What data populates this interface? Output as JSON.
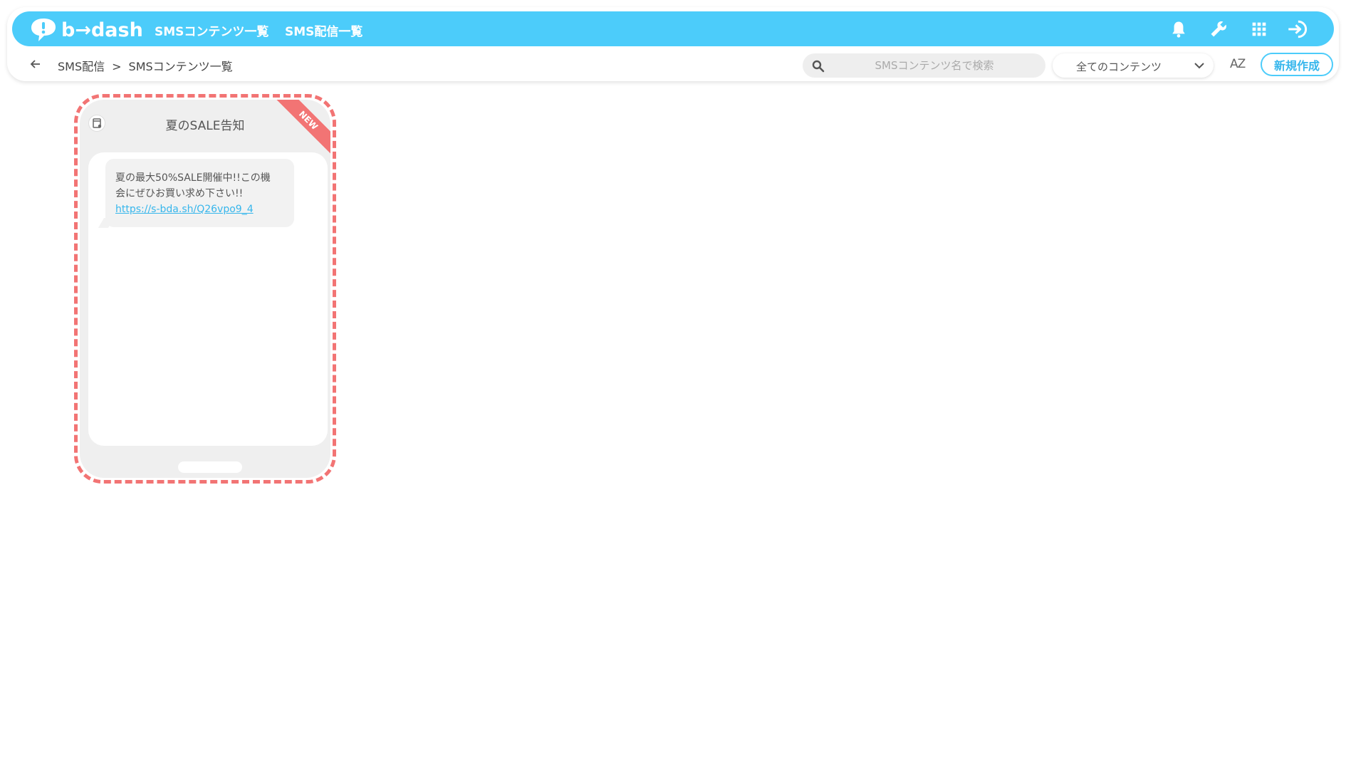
{
  "app": {
    "logo_text": "b→dash",
    "brand_color": "#4cccfa",
    "accent_color": "#f27474"
  },
  "nav": {
    "items": [
      {
        "label": "SMSコンテンツ一覧"
      },
      {
        "label": "SMS配信一覧"
      }
    ],
    "icons": [
      "bell-icon",
      "wrench-icon",
      "apps-grid-icon",
      "logout-icon"
    ]
  },
  "breadcrumb": {
    "parent": "SMS配信",
    "separator": ">",
    "current": "SMSコンテンツ一覧"
  },
  "search": {
    "placeholder": "SMSコンテンツ名で検索",
    "value": ""
  },
  "filter": {
    "selected": "全てのコンテンツ"
  },
  "sort": {
    "label": "AZ"
  },
  "toolbar": {
    "new_label": "新規作成"
  },
  "cards": [
    {
      "badge": "NEW",
      "title": "夏のSALE告知",
      "message_line1": "夏の最大50%SALE開催中!!この機",
      "message_line2": "会にぜひお買い求め下さい!!",
      "link": "https://s-bda.sh/Q26vpo9_4"
    }
  ]
}
